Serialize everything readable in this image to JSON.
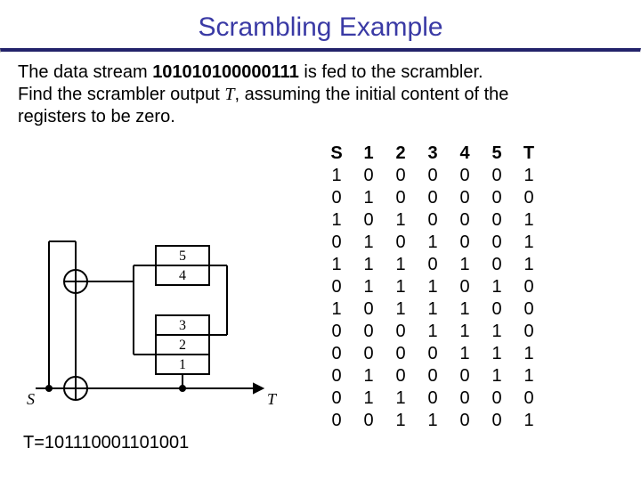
{
  "title": "Scrambling Example",
  "prose": {
    "line1a": "The data stream ",
    "stream": "101010100000111",
    "line1b": " is fed to the scrambler.",
    "line2a": "Find the scrambler output ",
    "tvar": "T",
    "line2b": ", assuming the initial content of the",
    "line3": "registers to be zero."
  },
  "table": {
    "headers": [
      "S",
      "1",
      "2",
      "3",
      "4",
      "5",
      "T"
    ],
    "rows": [
      [
        "1",
        "0",
        "0",
        "0",
        "0",
        "0",
        "1"
      ],
      [
        "0",
        "1",
        "0",
        "0",
        "0",
        "0",
        "0"
      ],
      [
        "1",
        "0",
        "1",
        "0",
        "0",
        "0",
        "1"
      ],
      [
        "0",
        "1",
        "0",
        "1",
        "0",
        "0",
        "1"
      ],
      [
        "1",
        "1",
        "1",
        "0",
        "1",
        "0",
        "1"
      ],
      [
        "0",
        "1",
        "1",
        "1",
        "0",
        "1",
        "0"
      ],
      [
        "1",
        "0",
        "1",
        "1",
        "1",
        "0",
        "0"
      ],
      [
        "0",
        "0",
        "0",
        "1",
        "1",
        "1",
        "0"
      ],
      [
        "0",
        "0",
        "0",
        "0",
        "1",
        "1",
        "1"
      ],
      [
        "0",
        "1",
        "0",
        "0",
        "0",
        "1",
        "1"
      ],
      [
        "0",
        "1",
        "1",
        "0",
        "0",
        "0",
        "0"
      ],
      [
        "0",
        "0",
        "1",
        "1",
        "0",
        "0",
        "1"
      ]
    ]
  },
  "diagram": {
    "s_label": "S",
    "t_label": "T",
    "taps": [
      "5",
      "4",
      "3",
      "2",
      "1"
    ]
  },
  "result_label": "T=",
  "result_value": "101110001101001"
}
